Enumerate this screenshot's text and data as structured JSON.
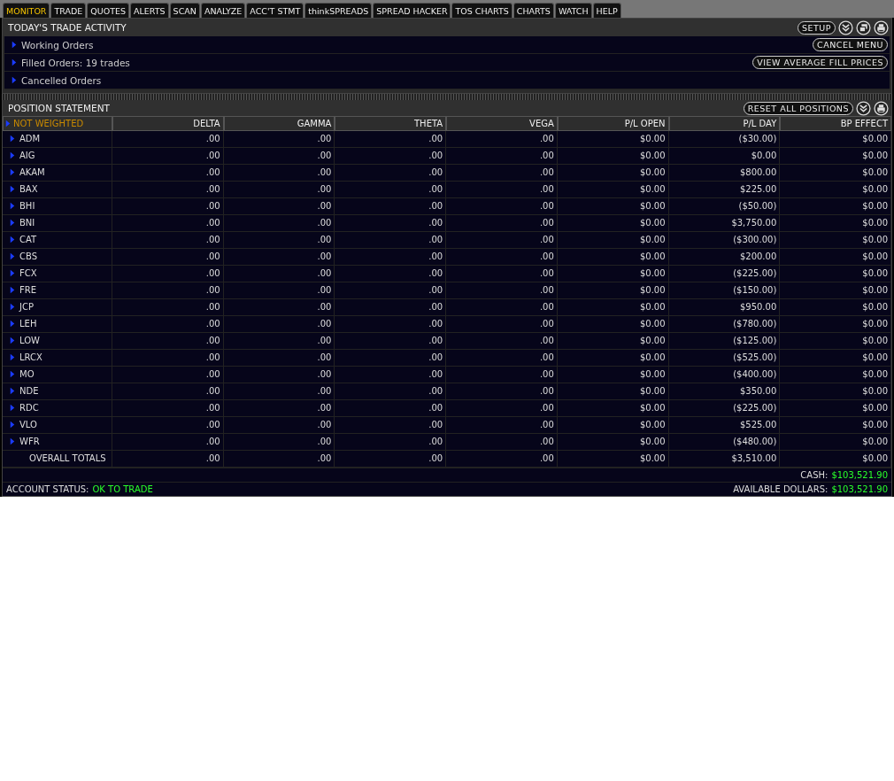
{
  "tabs": [
    {
      "label": "MONITOR",
      "selected": true
    },
    {
      "label": "TRADE",
      "selected": false
    },
    {
      "label": "QUOTES",
      "selected": false
    },
    {
      "label": "ALERTS",
      "selected": false
    },
    {
      "label": "SCAN",
      "selected": false
    },
    {
      "label": "ANALYZE",
      "selected": false
    },
    {
      "label": "ACC'T STMT",
      "selected": false
    },
    {
      "label": "thinkSPREADS",
      "selected": false
    },
    {
      "label": "SPREAD HACKER",
      "selected": false
    },
    {
      "label": "TOS CHARTS",
      "selected": false
    },
    {
      "label": "CHARTS",
      "selected": false
    },
    {
      "label": "WATCH",
      "selected": false
    },
    {
      "label": "HELP",
      "selected": false
    }
  ],
  "trade_activity": {
    "title": "TODAY'S TRADE ACTIVITY",
    "setup_button": "SETUP",
    "items": [
      {
        "label": "Working Orders",
        "expanded": false,
        "button": "CANCEL MENU"
      },
      {
        "label": "Filled Orders: 19 trades",
        "expanded": false,
        "button": "VIEW AVERAGE FILL PRICES"
      },
      {
        "label": "Cancelled Orders",
        "expanded": false
      }
    ]
  },
  "position_statement": {
    "title": "POSITION STATEMENT",
    "reset_button": "RESET ALL POSITIONS",
    "columns": [
      "NOT WEIGHTED",
      "DELTA",
      "GAMMA",
      "THETA",
      "VEGA",
      "P/L OPEN",
      "P/L DAY",
      "BP EFFECT"
    ],
    "rows": [
      {
        "expanded": false,
        "cells": [
          "ADM",
          ".00",
          ".00",
          ".00",
          ".00",
          "$0.00",
          "($30.00)",
          "$0.00"
        ]
      },
      {
        "expanded": false,
        "cells": [
          "AIG",
          ".00",
          ".00",
          ".00",
          ".00",
          "$0.00",
          "$0.00",
          "$0.00"
        ]
      },
      {
        "expanded": false,
        "cells": [
          "AKAM",
          ".00",
          ".00",
          ".00",
          ".00",
          "$0.00",
          "$800.00",
          "$0.00"
        ]
      },
      {
        "expanded": false,
        "cells": [
          "BAX",
          ".00",
          ".00",
          ".00",
          ".00",
          "$0.00",
          "$225.00",
          "$0.00"
        ]
      },
      {
        "expanded": false,
        "cells": [
          "BHI",
          ".00",
          ".00",
          ".00",
          ".00",
          "$0.00",
          "($50.00)",
          "$0.00"
        ]
      },
      {
        "expanded": false,
        "cells": [
          "BNI",
          ".00",
          ".00",
          ".00",
          ".00",
          "$0.00",
          "$3,750.00",
          "$0.00"
        ]
      },
      {
        "expanded": false,
        "cells": [
          "CAT",
          ".00",
          ".00",
          ".00",
          ".00",
          "$0.00",
          "($300.00)",
          "$0.00"
        ]
      },
      {
        "expanded": false,
        "cells": [
          "CBS",
          ".00",
          ".00",
          ".00",
          ".00",
          "$0.00",
          "$200.00",
          "$0.00"
        ]
      },
      {
        "expanded": false,
        "cells": [
          "FCX",
          ".00",
          ".00",
          ".00",
          ".00",
          "$0.00",
          "($225.00)",
          "$0.00"
        ]
      },
      {
        "expanded": false,
        "cells": [
          "FRE",
          ".00",
          ".00",
          ".00",
          ".00",
          "$0.00",
          "($150.00)",
          "$0.00"
        ]
      },
      {
        "expanded": false,
        "cells": [
          "JCP",
          ".00",
          ".00",
          ".00",
          ".00",
          "$0.00",
          "$950.00",
          "$0.00"
        ]
      },
      {
        "expanded": false,
        "cells": [
          "LEH",
          ".00",
          ".00",
          ".00",
          ".00",
          "$0.00",
          "($780.00)",
          "$0.00"
        ]
      },
      {
        "expanded": false,
        "cells": [
          "LOW",
          ".00",
          ".00",
          ".00",
          ".00",
          "$0.00",
          "($125.00)",
          "$0.00"
        ]
      },
      {
        "expanded": false,
        "cells": [
          "LRCX",
          ".00",
          ".00",
          ".00",
          ".00",
          "$0.00",
          "($525.00)",
          "$0.00"
        ]
      },
      {
        "expanded": false,
        "cells": [
          "MO",
          ".00",
          ".00",
          ".00",
          ".00",
          "$0.00",
          "($400.00)",
          "$0.00"
        ]
      },
      {
        "expanded": false,
        "cells": [
          "NDE",
          ".00",
          ".00",
          ".00",
          ".00",
          "$0.00",
          "$350.00",
          "$0.00"
        ]
      },
      {
        "expanded": false,
        "cells": [
          "RDC",
          ".00",
          ".00",
          ".00",
          ".00",
          "$0.00",
          "($225.00)",
          "$0.00"
        ]
      },
      {
        "expanded": false,
        "cells": [
          "VLO",
          ".00",
          ".00",
          ".00",
          ".00",
          "$0.00",
          "$525.00",
          "$0.00"
        ]
      },
      {
        "expanded": false,
        "cells": [
          "WFR",
          ".00",
          ".00",
          ".00",
          ".00",
          "$0.00",
          "($480.00)",
          "$0.00"
        ]
      }
    ],
    "totals": {
      "cells": [
        "OVERALL TOTALS",
        ".00",
        ".00",
        ".00",
        ".00",
        "$0.00",
        "$3,510.00",
        "$0.00"
      ]
    },
    "cash": {
      "label": "CASH:",
      "value": "$103,521.90"
    },
    "account_status": {
      "label": "ACCOUNT STATUS:",
      "value": "OK TO TRADE"
    },
    "available": {
      "label": "AVAILABLE DOLLARS:",
      "value": "$103,521.90"
    }
  }
}
